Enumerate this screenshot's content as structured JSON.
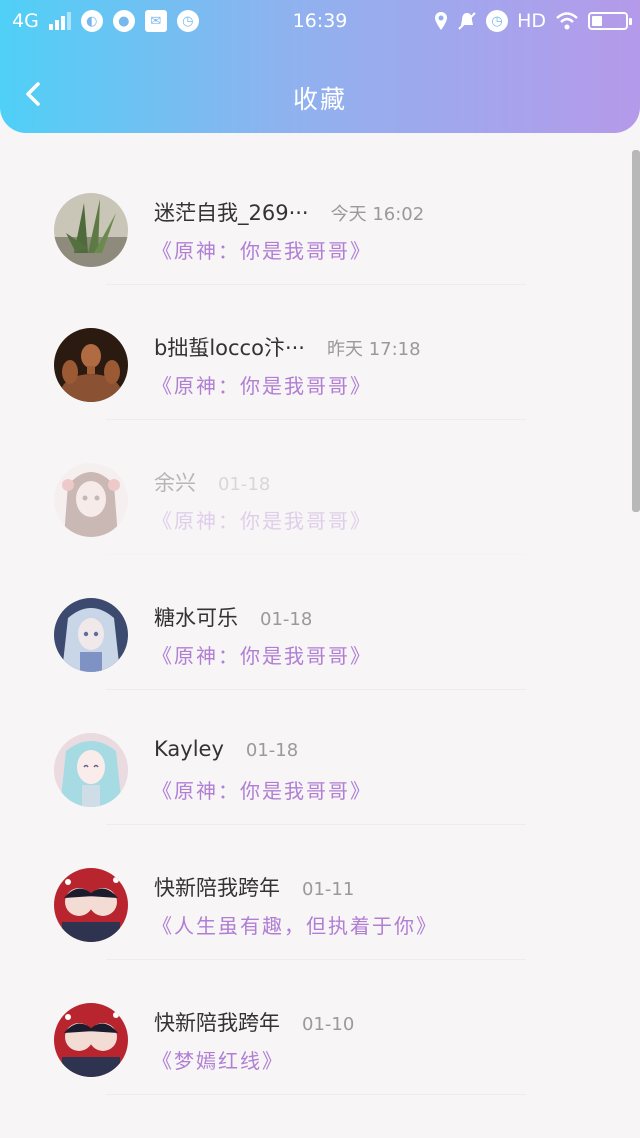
{
  "status_bar": {
    "network": "4G",
    "time": "16:39",
    "hd": "HD"
  },
  "header": {
    "title": "收藏"
  },
  "favorites": [
    {
      "name": "迷茫自我_269···",
      "time": "今天 16:02",
      "work": "《原神：你是我哥哥》"
    },
    {
      "name": "b拙蜇locco汴···",
      "time": "昨天 17:18",
      "work": "《原神：你是我哥哥》"
    },
    {
      "name": "余兴",
      "time": "01-18",
      "work": "《原神：你是我哥哥》"
    },
    {
      "name": "糖水可乐",
      "time": "01-18",
      "work": "《原神：你是我哥哥》"
    },
    {
      "name": "Kayley",
      "time": "01-18",
      "work": "《原神：你是我哥哥》"
    },
    {
      "name": "快新陪我跨年",
      "time": "01-11",
      "work": "《人生虽有趣，但执着于你》"
    },
    {
      "name": "快新陪我跨年",
      "time": "01-10",
      "work": "《梦嫣红线》"
    }
  ],
  "colors": {
    "header_gradient_start": "#4fd0f6",
    "header_gradient_end": "#b59aea",
    "work_title": "#b07fd4"
  }
}
